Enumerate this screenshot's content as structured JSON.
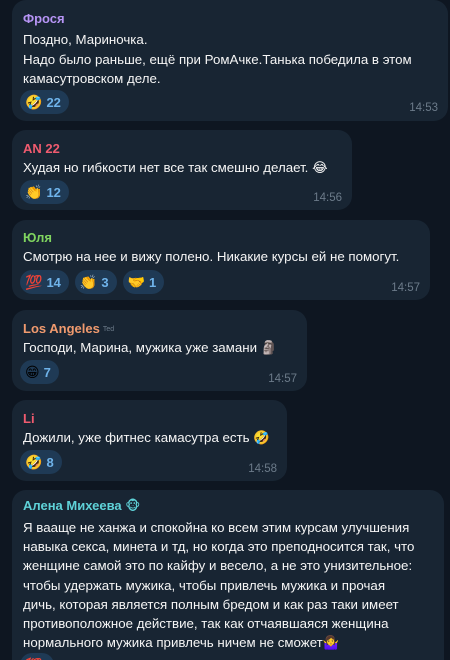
{
  "messages": [
    {
      "sender": "Фрося",
      "sender_color": "#b694f5",
      "lines": [
        "Поздно, Мариночка.",
        "Надо было раньше, ещё при РомАчке.Танька победила в этом",
        "камасутровском деле."
      ],
      "reactions": [
        {
          "emoji": "🤣",
          "count": "22"
        }
      ],
      "time": "14:53"
    },
    {
      "sender": "AN 22",
      "sender_color": "#ef5b6f",
      "lines": [
        "Худая но гибкости нет все так смешно делает. 😂"
      ],
      "reactions": [
        {
          "emoji": "👏",
          "count": "12"
        }
      ],
      "time": "14:56"
    },
    {
      "sender": "Юля",
      "sender_color": "#7fd45f",
      "lines": [
        "Смотрю на нее и вижу полено. Никакие курсы ей не помогут."
      ],
      "reactions": [
        {
          "emoji": "💯",
          "count": "14"
        },
        {
          "emoji": "👏",
          "count": "3"
        },
        {
          "emoji": "🤝",
          "count": "1"
        }
      ],
      "time": "14:57"
    },
    {
      "sender": "Los Angeles",
      "sender_tag": "Ted",
      "sender_color": "#f09a6e",
      "lines": [
        "Господи, Марина, мужика уже замани 🗿"
      ],
      "reactions": [
        {
          "emoji": "😁",
          "count": "7"
        }
      ],
      "time": "14:57"
    },
    {
      "sender": "Li",
      "sender_color": "#ef5b6f",
      "lines": [
        "Дожили, уже фитнес камасутра есть 🤣"
      ],
      "reactions": [
        {
          "emoji": "🤣",
          "count": "8"
        }
      ],
      "time": "14:58"
    },
    {
      "sender": "Алена Михеева 🐵",
      "sender_color": "#5fd2d8",
      "lines": [
        "Я вааще не ханжа и спокойна ко всем этим курсам улучшения",
        "навыка секса, минета и тд, но когда это преподносится так, что",
        "женщине самой это по кайфу и весело, а не это унизительное:",
        "чтобы удержать мужика, чтобы привлечь мужика и прочая",
        "дичь, которая является полным бредом и как раз таки имеет",
        "противоположное действие, так как отчаявшаяся женщина",
        "нормального мужика привлечь ничем не сможет🤷‍♀️"
      ],
      "reactions": [
        {
          "emoji": "💯",
          "count": ""
        }
      ],
      "time": ""
    }
  ]
}
